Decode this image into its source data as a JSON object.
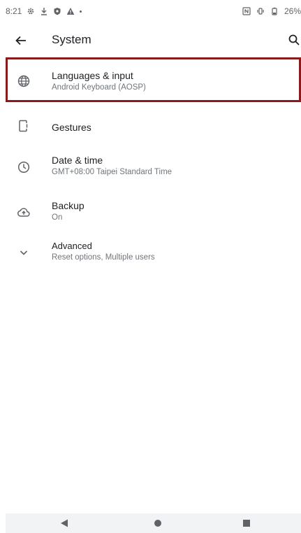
{
  "status_bar": {
    "time": "8:21",
    "battery": "26%",
    "icons": [
      "settings-icon",
      "download-icon",
      "shield-icon",
      "warning-icon",
      "dot-icon",
      "nfc-icon",
      "vibrate-icon",
      "battery-icon"
    ]
  },
  "app_bar": {
    "title": "System",
    "back_icon": "arrow-back-icon",
    "search_icon": "search-icon"
  },
  "items": [
    {
      "icon": "globe-icon",
      "title": "Languages & input",
      "subtitle": "Android Keyboard (AOSP)"
    },
    {
      "icon": "gestures-icon",
      "title": "Gestures"
    },
    {
      "icon": "clock-icon",
      "title": "Date & time",
      "subtitle": "GMT+08:00 Taipei Standard Time"
    },
    {
      "icon": "cloud-upload-icon",
      "title": "Backup",
      "subtitle": "On"
    },
    {
      "icon": "chevron-down-icon",
      "title": "Advanced",
      "subtitle": "Reset options, Multiple users"
    }
  ],
  "nav_bar": {
    "buttons": [
      "back-triangle-icon",
      "home-circle-icon",
      "recents-square-icon"
    ]
  },
  "colors": {
    "highlight": "#8b1a1a",
    "icon": "#5f6368",
    "text_primary": "#202124",
    "text_secondary": "#70757a",
    "nav_bar_bg": "#f1f3f4"
  }
}
